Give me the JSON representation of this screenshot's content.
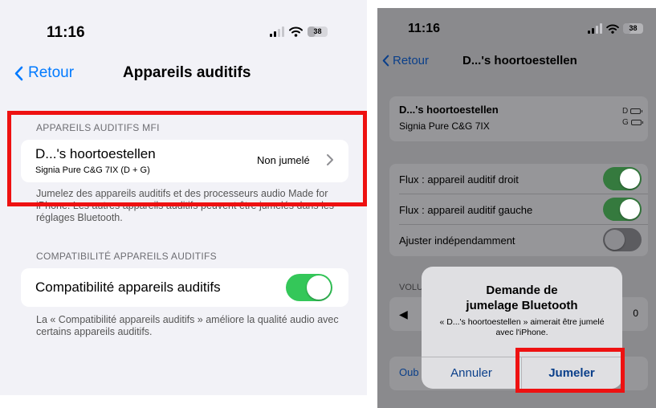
{
  "left_screen": {
    "time": "11:16",
    "battery": "38",
    "nav": {
      "back_label": "Retour",
      "title": "Appareils auditifs"
    },
    "mfi_section": {
      "header": "APPAREILS AUDITIFS MFI",
      "device_name": "D...'s hoortoestellen",
      "device_model": "Signia Pure C&G 7IX (D + G)",
      "device_status": "Non jumelé",
      "footer": "Jumelez des appareils auditifs et des processeurs audio Made for iPhone. Les autres appareils auditifs peuvent être jumelés dans les réglages Bluetooth."
    },
    "compat_section": {
      "header": "COMPATIBILITÉ APPAREILS AUDITIFS",
      "label": "Compatibilité appareils auditifs",
      "toggle_on": true,
      "footer": "La « Compatibilité appareils auditifs » améliore la qualité audio avec certains appareils auditifs."
    }
  },
  "right_screen": {
    "time": "11:16",
    "battery": "38",
    "nav": {
      "back_label": "Retour",
      "title": "D...'s hoortoestellen"
    },
    "device": {
      "name": "D...'s hoortoestellen",
      "model": "Signia Pure C&G 7IX",
      "right_label": "D",
      "left_label": "G"
    },
    "toggles": [
      {
        "label": "Flux : appareil auditif droit",
        "on": true
      },
      {
        "label": "Flux : appareil auditif gauche",
        "on": true
      },
      {
        "label": "Ajuster indépendamment",
        "on": false
      }
    ],
    "volume": {
      "label": "VOLU",
      "value": "0"
    },
    "forget_label": "Oub",
    "dialog": {
      "title_line1": "Demande de",
      "title_line2": "jumelage Bluetooth",
      "message": "« D...'s hoortoestellen » aimerait être jumelé avec l'iPhone.",
      "cancel_label": "Annuler",
      "confirm_label": "Jumeler"
    }
  },
  "colors": {
    "ios_blue": "#007aff",
    "toggle_green": "#34c759",
    "highlight_red": "#ee1111",
    "grouped_bg": "#f2f2f7"
  },
  "icons": [
    "cellular-signal-icon",
    "wifi-icon",
    "battery-icon",
    "chevron-left-icon",
    "chevron-right-icon",
    "speaker-icon"
  ]
}
